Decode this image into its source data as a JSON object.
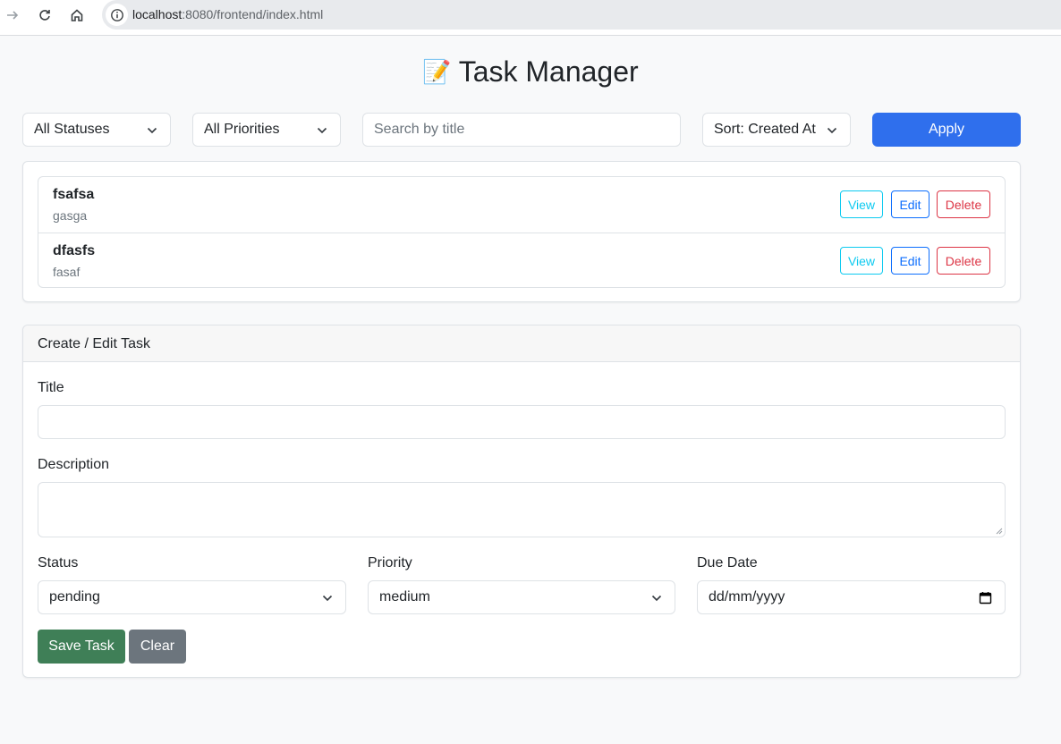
{
  "browser": {
    "url_host": "localhost",
    "url_rest": ":8080/frontend/index.html"
  },
  "header": {
    "emoji": "📝",
    "title": "Task Manager"
  },
  "filters": {
    "status_selected": "All Statuses",
    "priority_selected": "All Priorities",
    "search_placeholder": "Search by title",
    "sort_selected": "Sort: Created At",
    "apply_label": "Apply"
  },
  "tasks": [
    {
      "title": "fsafsa",
      "description": "gasga"
    },
    {
      "title": "dfasfs",
      "description": "fasaf"
    }
  ],
  "task_actions": {
    "view_label": "View",
    "edit_label": "Edit",
    "delete_label": "Delete"
  },
  "form": {
    "header": "Create / Edit Task",
    "title_label": "Title",
    "title_value": "",
    "description_label": "Description",
    "description_value": "",
    "status_label": "Status",
    "status_value": "pending",
    "priority_label": "Priority",
    "priority_value": "medium",
    "due_date_label": "Due Date",
    "due_date_value": "dd/mm/yyyy",
    "save_label": "Save Task",
    "clear_label": "Clear"
  },
  "colors": {
    "primary": "#2f6fed",
    "success": "#3f7f57",
    "secondary": "#6c757d",
    "info": "#0dcaf0",
    "danger": "#dc3545"
  }
}
